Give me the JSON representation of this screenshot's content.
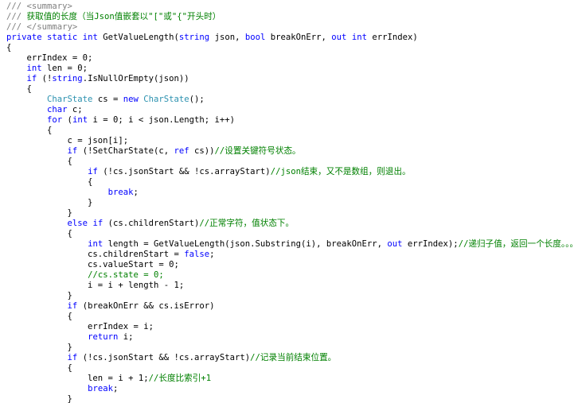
{
  "editor": {
    "lines": [
      [
        {
          "t": "/// ",
          "c": "xd"
        },
        {
          "t": "<summary>",
          "c": "xd"
        }
      ],
      [
        {
          "t": "/// ",
          "c": "xd"
        },
        {
          "t": "获取值的长度（当Json值嵌套以\"[\"或\"{\"开头时）",
          "c": "cm"
        }
      ],
      [
        {
          "t": "/// ",
          "c": "xd"
        },
        {
          "t": "</summary>",
          "c": "xd"
        }
      ],
      [
        {
          "t": "private",
          "c": "kw"
        },
        {
          "t": " ",
          "c": "pl"
        },
        {
          "t": "static",
          "c": "kw"
        },
        {
          "t": " ",
          "c": "pl"
        },
        {
          "t": "int",
          "c": "kw"
        },
        {
          "t": " GetValueLength(",
          "c": "pl"
        },
        {
          "t": "string",
          "c": "kw"
        },
        {
          "t": " json, ",
          "c": "pl"
        },
        {
          "t": "bool",
          "c": "kw"
        },
        {
          "t": " breakOnErr, ",
          "c": "pl"
        },
        {
          "t": "out",
          "c": "kw"
        },
        {
          "t": " ",
          "c": "pl"
        },
        {
          "t": "int",
          "c": "kw"
        },
        {
          "t": " errIndex)",
          "c": "pl"
        }
      ],
      [
        {
          "t": "{",
          "c": "pl"
        }
      ],
      [
        {
          "t": "    errIndex = 0;",
          "c": "pl"
        }
      ],
      [
        {
          "t": "    ",
          "c": "pl"
        },
        {
          "t": "int",
          "c": "kw"
        },
        {
          "t": " len = 0;",
          "c": "pl"
        }
      ],
      [
        {
          "t": "    ",
          "c": "pl"
        },
        {
          "t": "if",
          "c": "kw"
        },
        {
          "t": " (!",
          "c": "pl"
        },
        {
          "t": "string",
          "c": "kw"
        },
        {
          "t": ".IsNullOrEmpty(json))",
          "c": "pl"
        }
      ],
      [
        {
          "t": "    {",
          "c": "pl"
        }
      ],
      [
        {
          "t": "        ",
          "c": "pl"
        },
        {
          "t": "CharState",
          "c": "ty"
        },
        {
          "t": " cs = ",
          "c": "pl"
        },
        {
          "t": "new",
          "c": "kw"
        },
        {
          "t": " ",
          "c": "pl"
        },
        {
          "t": "CharState",
          "c": "ty"
        },
        {
          "t": "();",
          "c": "pl"
        }
      ],
      [
        {
          "t": "        ",
          "c": "pl"
        },
        {
          "t": "char",
          "c": "kw"
        },
        {
          "t": " c;",
          "c": "pl"
        }
      ],
      [
        {
          "t": "        ",
          "c": "pl"
        },
        {
          "t": "for",
          "c": "kw"
        },
        {
          "t": " (",
          "c": "pl"
        },
        {
          "t": "int",
          "c": "kw"
        },
        {
          "t": " i = 0; i < json.Length; i++)",
          "c": "pl"
        }
      ],
      [
        {
          "t": "        {",
          "c": "pl"
        }
      ],
      [
        {
          "t": "            c = json[i];",
          "c": "pl"
        }
      ],
      [
        {
          "t": "            ",
          "c": "pl"
        },
        {
          "t": "if",
          "c": "kw"
        },
        {
          "t": " (!SetCharState(c, ",
          "c": "pl"
        },
        {
          "t": "ref",
          "c": "kw"
        },
        {
          "t": " cs))",
          "c": "pl"
        },
        {
          "t": "//设置关键符号状态。",
          "c": "cm"
        }
      ],
      [
        {
          "t": "            {",
          "c": "pl"
        }
      ],
      [
        {
          "t": "                ",
          "c": "pl"
        },
        {
          "t": "if",
          "c": "kw"
        },
        {
          "t": " (!cs.jsonStart && !cs.arrayStart)",
          "c": "pl"
        },
        {
          "t": "//json结束，又不是数组，则退出。",
          "c": "cm"
        }
      ],
      [
        {
          "t": "                {",
          "c": "pl"
        }
      ],
      [
        {
          "t": "                    ",
          "c": "pl"
        },
        {
          "t": "break",
          "c": "kw"
        },
        {
          "t": ";",
          "c": "pl"
        }
      ],
      [
        {
          "t": "                }",
          "c": "pl"
        }
      ],
      [
        {
          "t": "            }",
          "c": "pl"
        }
      ],
      [
        {
          "t": "            ",
          "c": "pl"
        },
        {
          "t": "else",
          "c": "kw"
        },
        {
          "t": " ",
          "c": "pl"
        },
        {
          "t": "if",
          "c": "kw"
        },
        {
          "t": " (cs.childrenStart)",
          "c": "pl"
        },
        {
          "t": "//正常字符，值状态下。",
          "c": "cm"
        }
      ],
      [
        {
          "t": "            {",
          "c": "pl"
        }
      ],
      [
        {
          "t": "                ",
          "c": "pl"
        },
        {
          "t": "int",
          "c": "kw"
        },
        {
          "t": " length = GetValueLength(json.Substring(i), breakOnErr, ",
          "c": "pl"
        },
        {
          "t": "out",
          "c": "kw"
        },
        {
          "t": " errIndex);",
          "c": "pl"
        },
        {
          "t": "//递归子值，返回一个长度。。。",
          "c": "cm"
        }
      ],
      [
        {
          "t": "                cs.childrenStart = ",
          "c": "pl"
        },
        {
          "t": "false",
          "c": "kw"
        },
        {
          "t": ";",
          "c": "pl"
        }
      ],
      [
        {
          "t": "                cs.valueStart = 0;",
          "c": "pl"
        }
      ],
      [
        {
          "t": "                ",
          "c": "pl"
        },
        {
          "t": "//cs.state = 0;",
          "c": "cm"
        }
      ],
      [
        {
          "t": "                i = i + length - 1;",
          "c": "pl"
        }
      ],
      [
        {
          "t": "            }",
          "c": "pl"
        }
      ],
      [
        {
          "t": "            ",
          "c": "pl"
        },
        {
          "t": "if",
          "c": "kw"
        },
        {
          "t": " (breakOnErr && cs.isError)",
          "c": "pl"
        }
      ],
      [
        {
          "t": "            {",
          "c": "pl"
        }
      ],
      [
        {
          "t": "                errIndex = i;",
          "c": "pl"
        }
      ],
      [
        {
          "t": "                ",
          "c": "pl"
        },
        {
          "t": "return",
          "c": "kw"
        },
        {
          "t": " i;",
          "c": "pl"
        }
      ],
      [
        {
          "t": "            }",
          "c": "pl"
        }
      ],
      [
        {
          "t": "            ",
          "c": "pl"
        },
        {
          "t": "if",
          "c": "kw"
        },
        {
          "t": " (!cs.jsonStart && !cs.arrayStart)",
          "c": "pl"
        },
        {
          "t": "//记录当前结束位置。",
          "c": "cm"
        }
      ],
      [
        {
          "t": "            {",
          "c": "pl"
        }
      ],
      [
        {
          "t": "                len = i + 1;",
          "c": "pl"
        },
        {
          "t": "//长度比索引+1",
          "c": "cm"
        }
      ],
      [
        {
          "t": "                ",
          "c": "pl"
        },
        {
          "t": "break",
          "c": "kw"
        },
        {
          "t": ";",
          "c": "pl"
        }
      ],
      [
        {
          "t": "            }",
          "c": "pl"
        }
      ]
    ]
  }
}
